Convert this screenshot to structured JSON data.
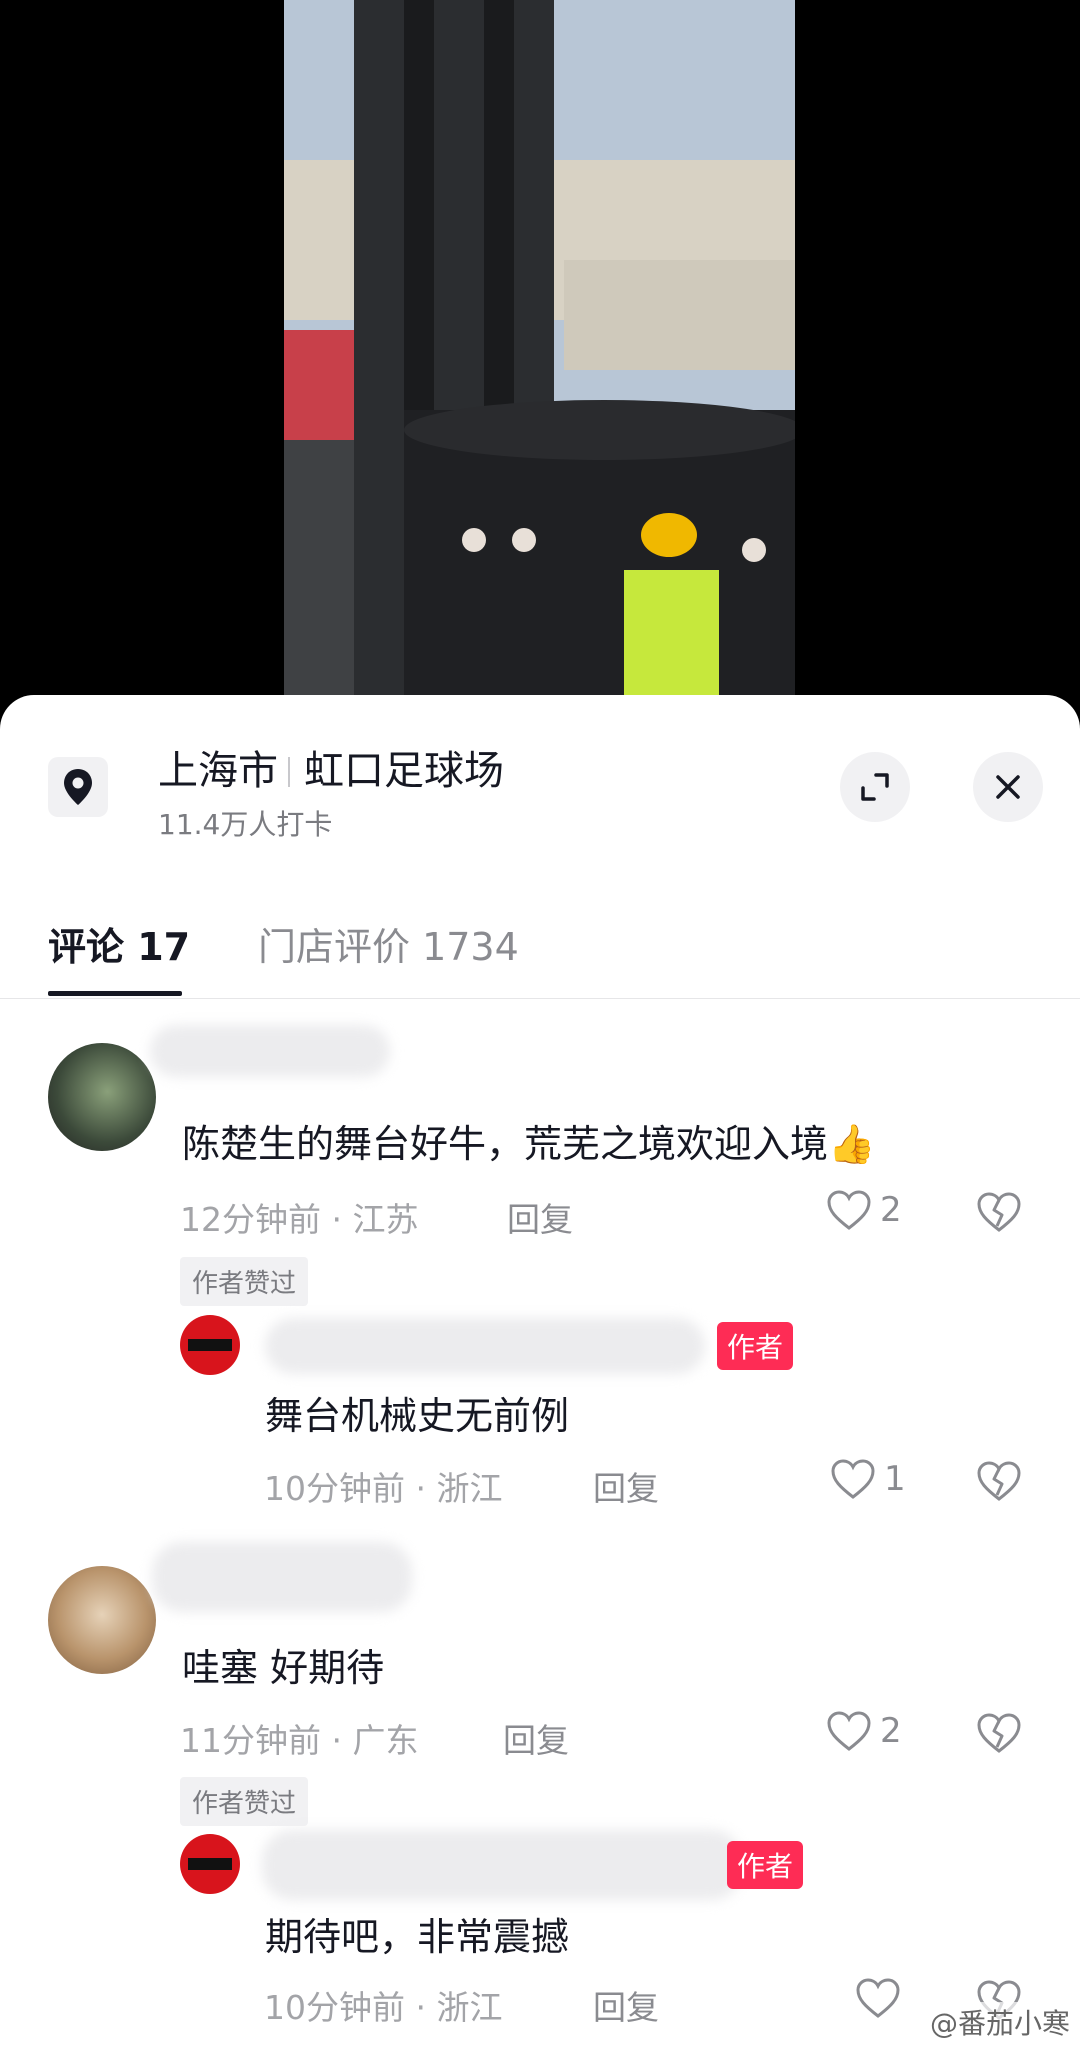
{
  "location": {
    "city": "上海市",
    "venue": "虹口足球场",
    "checkins": "11.4万人打卡",
    "pin_icon": "location-pin-icon",
    "expand_icon": "expand-icon",
    "close_icon": "close-icon"
  },
  "tabs": [
    {
      "label": "评论 17"
    },
    {
      "label": "门店评价 1734"
    }
  ],
  "comments": [
    {
      "text": "陈楚生的舞台好牛，荒芜之境欢迎入境👍",
      "time": "12分钟前 · 江苏",
      "reply": "回复",
      "likes": "2",
      "author_liked": "作者赞过",
      "replies": [
        {
          "badge": "作者",
          "text": "舞台机械史无前例",
          "time": "10分钟前 · 浙江",
          "reply": "回复",
          "likes": "1"
        }
      ]
    },
    {
      "text": "哇塞 好期待",
      "time": "11分钟前 · 广东",
      "reply": "回复",
      "likes": "2",
      "author_liked": "作者赞过",
      "replies": [
        {
          "badge": "作者",
          "text": "期待吧，非常震撼",
          "time": "10分钟前 · 浙江",
          "reply": "回复",
          "likes": ""
        }
      ]
    }
  ],
  "watermark": "@番茄小寒",
  "colors": {
    "accent": "#fe2c55",
    "text": "#161823",
    "muted": "#a3a4a8"
  }
}
